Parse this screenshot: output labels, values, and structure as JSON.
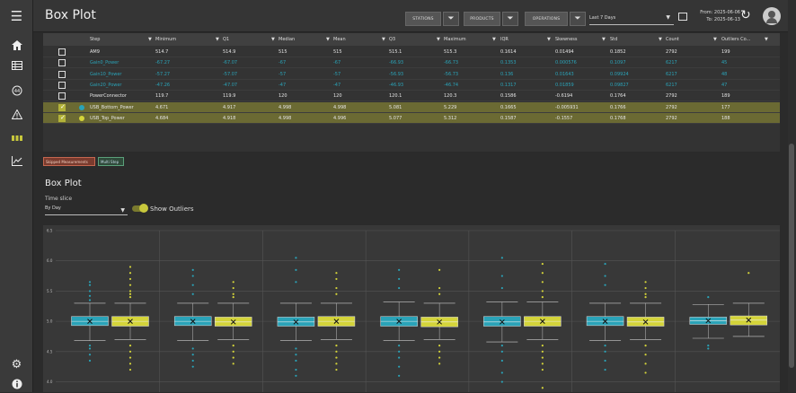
{
  "app": {
    "title": "Box Plot",
    "filters": {
      "stations": "STATIONS",
      "products": "PRODUCTS",
      "operations": "OPERATIONS"
    },
    "time_range": "Last 7 Days",
    "from_label": "From: 2025-06-06",
    "to_label": "To: 2025-06-13"
  },
  "table": {
    "columns": [
      "Step",
      "Minimum",
      "Q1",
      "Median",
      "Mean",
      "Q3",
      "Maximum",
      "IQR",
      "Skewness",
      "Std",
      "Count",
      "Outliers Co..."
    ],
    "rows": [
      {
        "checked": false,
        "dot": "",
        "style": "normal",
        "cells": [
          "AM9",
          "514.7",
          "514.9",
          "515",
          "515",
          "515.1",
          "515.3",
          "0.1614",
          "0.01494",
          "0.1852",
          "2792",
          "199"
        ]
      },
      {
        "checked": false,
        "dot": "",
        "style": "teal",
        "cells": [
          "Gain0_Power",
          "-67.27",
          "-67.07",
          "-67",
          "-67",
          "-66.93",
          "-66.73",
          "0.1353",
          "0.000576",
          "0.1097",
          "6217",
          "45"
        ]
      },
      {
        "checked": false,
        "dot": "",
        "style": "teal",
        "cells": [
          "Gain10_Power",
          "-57.27",
          "-57.07",
          "-57",
          "-57",
          "-56.93",
          "-56.73",
          "0.136",
          "0.01643",
          "0.09924",
          "6217",
          "48"
        ]
      },
      {
        "checked": false,
        "dot": "",
        "style": "teal",
        "cells": [
          "Gain20_Power",
          "-47.26",
          "-47.07",
          "-47",
          "-47",
          "-46.93",
          "-46.74",
          "0.1317",
          "0.01859",
          "0.09827",
          "6217",
          "47"
        ]
      },
      {
        "checked": false,
        "dot": "",
        "style": "normal",
        "cells": [
          "PowerConnector",
          "119.7",
          "119.9",
          "120",
          "120",
          "120.1",
          "120.3",
          "0.1586",
          "-0.6194",
          "0.1764",
          "2792",
          "189"
        ]
      },
      {
        "checked": true,
        "dot": "#2aa3b8",
        "style": "sel",
        "cells": [
          "USB_Bottom_Power",
          "4.671",
          "4.917",
          "4.998",
          "4.998",
          "5.081",
          "5.229",
          "0.1665",
          "-0.005931",
          "0.1766",
          "2792",
          "177"
        ]
      },
      {
        "checked": true,
        "dot": "#d4d43a",
        "style": "sel",
        "cells": [
          "USB_Top_Power",
          "4.684",
          "4.918",
          "4.998",
          "4.996",
          "5.077",
          "5.312",
          "0.1587",
          "-0.1557",
          "0.1768",
          "2792",
          "188"
        ]
      }
    ]
  },
  "tags": {
    "skipped": "Skipped Measurements",
    "multi_step": "Multi Step"
  },
  "plot_section": {
    "title": "Box Plot",
    "time_slice_label": "Time slice",
    "time_slice_value": "By Day",
    "show_outliers_label": "Show Outliers"
  },
  "colors": {
    "teal": "#2aa3b8",
    "yellow": "#d4d43a",
    "sel_row": "#6b6a33"
  },
  "chart_data": {
    "type": "box",
    "y_ticks": [
      "6.5",
      "6.0",
      "5.5",
      "5.0",
      "4.5",
      "4.0"
    ],
    "ylim": [
      3.8,
      6.5
    ],
    "groups": 7,
    "series": [
      {
        "name": "USB_Bottom_Power",
        "color": "#2aa3b8",
        "boxes": [
          {
            "min": 4.68,
            "q1": 4.93,
            "median": 5.0,
            "q3": 5.08,
            "max": 5.3,
            "mean": 5.0,
            "outliers": [
              5.5,
              5.42,
              5.35,
              4.6,
              4.55,
              4.45,
              4.35,
              5.6,
              5.65
            ]
          },
          {
            "min": 4.68,
            "q1": 4.93,
            "median": 5.0,
            "q3": 5.08,
            "max": 5.3,
            "mean": 5.0,
            "outliers": [
              5.85,
              5.75,
              5.6,
              5.45,
              4.55,
              4.45,
              4.35,
              4.25
            ]
          },
          {
            "min": 4.68,
            "q1": 4.92,
            "median": 4.99,
            "q3": 5.07,
            "max": 5.3,
            "mean": 4.99,
            "outliers": [
              6.05,
              5.85,
              5.65,
              4.55,
              4.45,
              4.35,
              4.2,
              4.1
            ]
          },
          {
            "min": 4.68,
            "q1": 4.92,
            "median": 5.0,
            "q3": 5.08,
            "max": 5.32,
            "mean": 5.0,
            "outliers": [
              5.85,
              5.7,
              5.55,
              4.6,
              4.5,
              4.4,
              4.25,
              4.1
            ]
          },
          {
            "min": 4.66,
            "q1": 4.92,
            "median": 4.99,
            "q3": 5.08,
            "max": 5.32,
            "mean": 4.99,
            "outliers": [
              6.05,
              5.75,
              5.55,
              4.6,
              4.5,
              4.35,
              4.15,
              4.0
            ]
          },
          {
            "min": 4.68,
            "q1": 4.93,
            "median": 5.0,
            "q3": 5.08,
            "max": 5.3,
            "mean": 5.0,
            "outliers": [
              5.95,
              5.75,
              5.6,
              4.6,
              4.5,
              4.35,
              4.2
            ]
          },
          {
            "min": 4.72,
            "q1": 4.95,
            "median": 5.01,
            "q3": 5.07,
            "max": 5.28,
            "mean": 5.01,
            "outliers": [
              5.4,
              4.6,
              4.55
            ]
          }
        ]
      },
      {
        "name": "USB_Top_Power",
        "color": "#d4d43a",
        "boxes": [
          {
            "min": 4.7,
            "q1": 4.92,
            "median": 5.0,
            "q3": 5.08,
            "max": 5.3,
            "mean": 5.0,
            "outliers": [
              5.9,
              5.8,
              5.7,
              5.6,
              5.5,
              5.45,
              5.4,
              4.6,
              4.5,
              4.4,
              4.3,
              4.2
            ]
          },
          {
            "min": 4.7,
            "q1": 4.92,
            "median": 4.99,
            "q3": 5.07,
            "max": 5.3,
            "mean": 4.99,
            "outliers": [
              5.65,
              5.55,
              5.45,
              5.4,
              4.6,
              4.5,
              4.4,
              4.3
            ]
          },
          {
            "min": 4.7,
            "q1": 4.92,
            "median": 5.0,
            "q3": 5.08,
            "max": 5.3,
            "mean": 5.0,
            "outliers": [
              5.8,
              5.7,
              5.55,
              5.45,
              4.6,
              4.5,
              4.4,
              4.3,
              4.2
            ]
          },
          {
            "min": 4.7,
            "q1": 4.91,
            "median": 4.99,
            "q3": 5.07,
            "max": 5.3,
            "mean": 4.99,
            "outliers": [
              5.85,
              5.55,
              5.45,
              4.6,
              4.5,
              4.4,
              4.3
            ]
          },
          {
            "min": 4.7,
            "q1": 4.92,
            "median": 5.0,
            "q3": 5.08,
            "max": 5.32,
            "mean": 5.0,
            "outliers": [
              5.95,
              5.8,
              5.65,
              5.5,
              5.4,
              4.6,
              4.5,
              4.4,
              4.3,
              4.2,
              3.9
            ]
          },
          {
            "min": 4.7,
            "q1": 4.92,
            "median": 4.99,
            "q3": 5.07,
            "max": 5.3,
            "mean": 4.99,
            "outliers": [
              5.65,
              5.55,
              5.45,
              5.4,
              4.6,
              4.45,
              4.3,
              4.15
            ]
          },
          {
            "min": 4.75,
            "q1": 4.94,
            "median": 5.02,
            "q3": 5.09,
            "max": 5.3,
            "mean": 5.02,
            "outliers": [
              5.8
            ]
          }
        ]
      }
    ]
  }
}
